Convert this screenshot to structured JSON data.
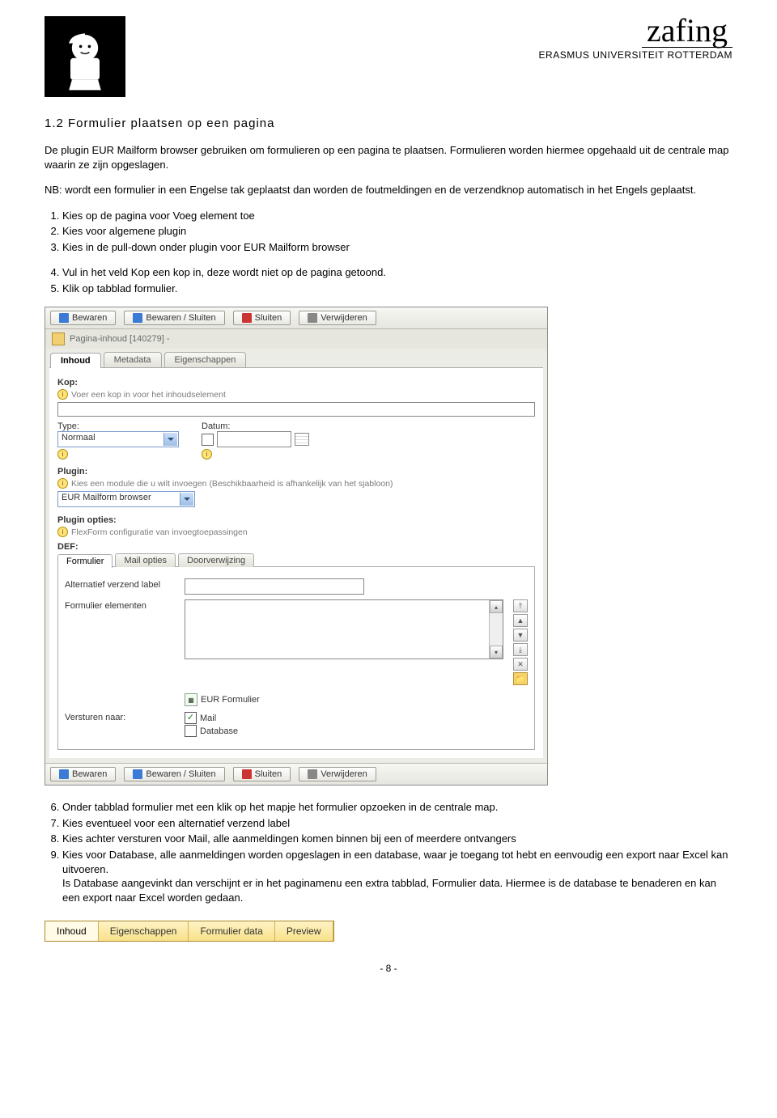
{
  "header": {
    "uni_label": "ERASMUS UNIVERSITEIT ROTTERDAM",
    "signature": "zafing"
  },
  "section_heading": "1.2  Formulier plaatsen op een pagina",
  "intro_p1": "De plugin EUR Mailform browser gebruiken om formulieren op een pagina te plaatsen. Formulieren worden hiermee opgehaald uit de centrale map waarin ze zijn opgeslagen.",
  "intro_p2": "NB: wordt een formulier in een Engelse tak geplaatst dan worden de foutmeldingen en de verzendknop automatisch in het Engels geplaatst.",
  "steps_a": [
    "Kies op de pagina voor Voeg element toe",
    "Kies voor algemene plugin",
    "Kies in de pull-down onder plugin voor EUR Mailform browser"
  ],
  "steps_b": [
    "Vul in het veld Kop een kop in, deze wordt niet op de pagina getoond.",
    "Klik op tabblad formulier."
  ],
  "cms": {
    "toolbar": {
      "save": "Bewaren",
      "save_close": "Bewaren / Sluiten",
      "close": "Sluiten",
      "delete": "Verwijderen"
    },
    "content_title": "Pagina-inhoud [140279] -",
    "tabs": {
      "inhoud": "Inhoud",
      "metadata": "Metadata",
      "eigenschappen": "Eigenschappen"
    },
    "kop_label": "Kop:",
    "kop_hint": "Voer een kop in voor het inhoudselement",
    "type_label": "Type:",
    "type_value": "Normaal",
    "datum_label": "Datum:",
    "plugin_label": "Plugin:",
    "plugin_hint": "Kies een module die u wilt invoegen (Beschikbaarheid is afhankelijk van het sjabloon)",
    "plugin_value": "EUR Mailform browser",
    "plugin_opties_label": "Plugin opties:",
    "plugin_opties_hint": "FlexForm configuratie van invoegtoepassingen",
    "def_label": "DEF:",
    "subtabs": {
      "formulier": "Formulier",
      "mail": "Mail opties",
      "doorverwijzing": "Doorverwijzing"
    },
    "alt_label": "Alternatief verzend label",
    "elem_label": "Formulier elementen",
    "eur_form_label": "EUR Formulier",
    "versturen_label": "Versturen naar:",
    "opt_mail": "Mail",
    "opt_db": "Database"
  },
  "steps_c": [
    "Onder tabblad formulier met een klik op het mapje het formulier opzoeken in de centrale map.",
    "Kies eventueel voor een alternatief verzend label",
    "Kies achter versturen voor Mail, alle aanmeldingen komen binnen bij een of meerdere ontvangers",
    "Kies voor Database, alle aanmeldingen worden opgeslagen in een database, waar je toegang tot hebt en eenvoudig een export naar Excel kan uitvoeren.\nIs Database aangevinkt dan verschijnt er in het paginamenu een extra tabblad, Formulier data. Hiermee is de database te benaderen en kan een export naar Excel worden gedaan."
  ],
  "tabstrip2": {
    "inhoud": "Inhoud",
    "eigenschappen": "Eigenschappen",
    "formulier_data": "Formulier data",
    "preview": "Preview"
  },
  "page_number": "- 8 -"
}
